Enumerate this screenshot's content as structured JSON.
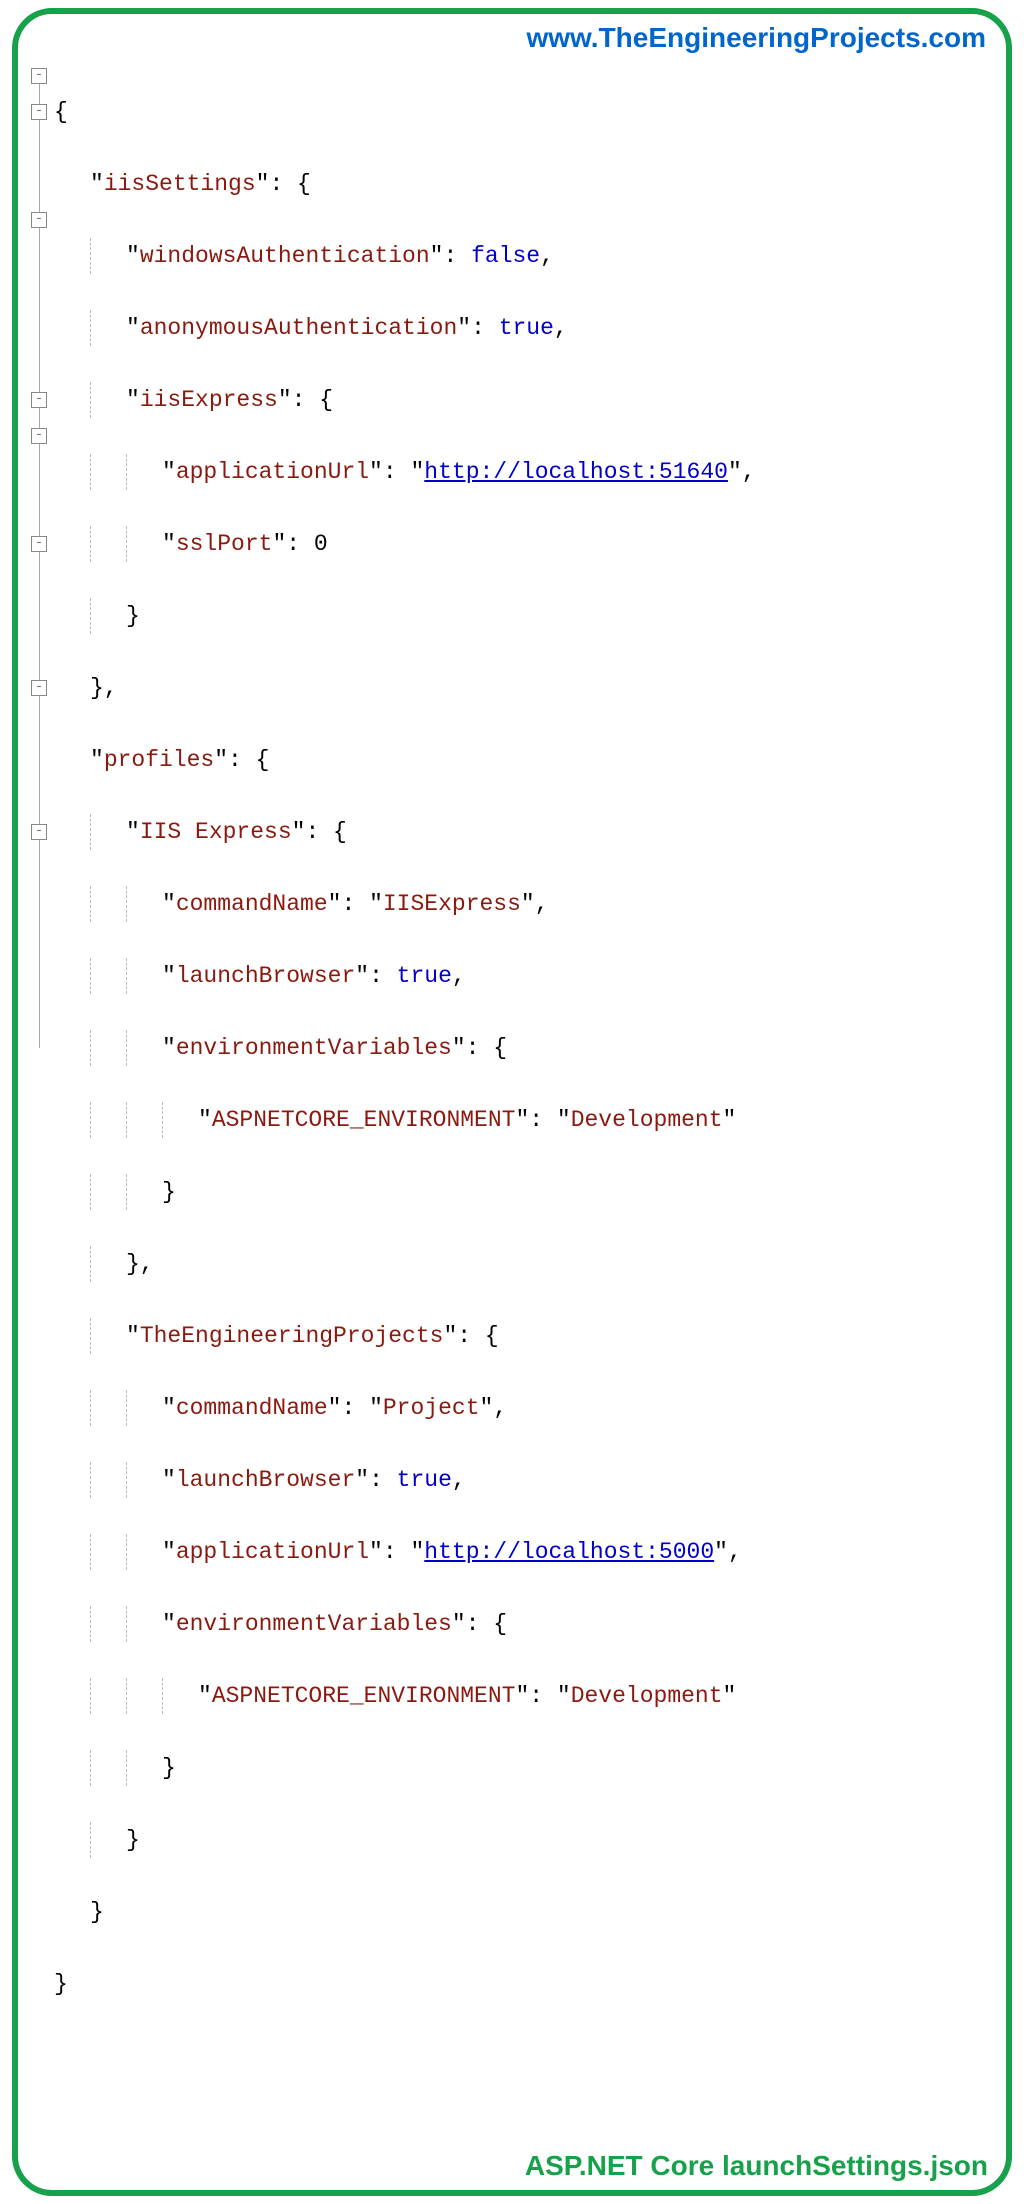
{
  "header_url": "www.TheEngineeringProjects.com",
  "footer_text": "ASP.NET Core launchSettings.json",
  "fold_glyph": "-",
  "keys": {
    "iisSettings": "iisSettings",
    "windowsAuthentication": "windowsAuthentication",
    "anonymousAuthentication": "anonymousAuthentication",
    "iisExpress": "iisExpress",
    "applicationUrl": "applicationUrl",
    "sslPort": "sslPort",
    "profiles": "profiles",
    "IISExpressProfile": "IIS Express",
    "commandName": "commandName",
    "launchBrowser": "launchBrowser",
    "environmentVariables": "environmentVariables",
    "ASPNETCORE_ENVIRONMENT": "ASPNETCORE_ENVIRONMENT",
    "TheEngineeringProjects": "TheEngineeringProjects"
  },
  "values": {
    "false": "false",
    "true": "true",
    "zero": "0",
    "url1": "http://localhost:51640",
    "url2": "http://localhost:5000",
    "IISExpressVal": "IISExpress",
    "ProjectVal": "Project",
    "DevelopmentVal": "Development"
  }
}
